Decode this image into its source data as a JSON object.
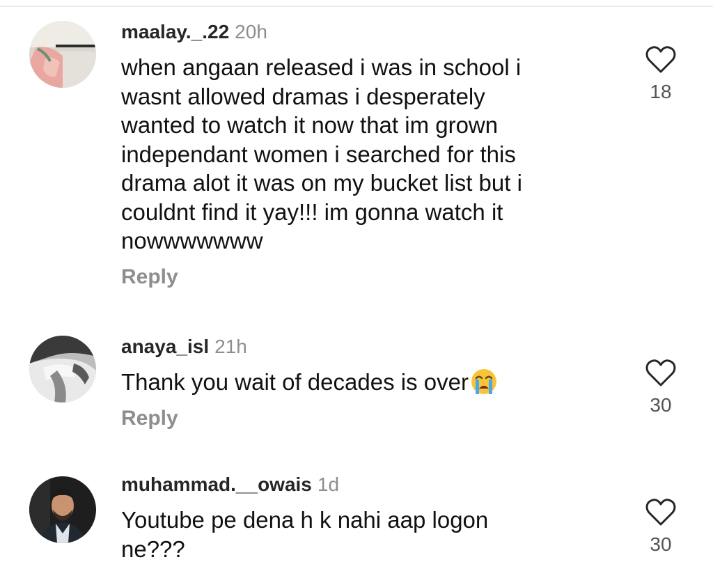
{
  "comments": [
    {
      "username": "maalay._.22",
      "time": "20h",
      "text": "when angaan released i was in school  i\nwasnt allowed dramas i desperately\nwanted to watch it now that im grown\nindependant women i searched for this\ndrama alot it was on my bucket list but i\ncouldnt find it yay!!! im gonna watch it\nnowwwwwww",
      "reply_label": "Reply",
      "likes": "18"
    },
    {
      "username": "anaya_isl",
      "time": "21h",
      "text": "Thank you wait of decades is over",
      "emoji": "loudly-crying-face",
      "reply_label": "Reply",
      "likes": "30"
    },
    {
      "username": "muhammad.__owais",
      "time": "1d",
      "text": "Youtube pe dena h k nahi aap logon\nne???",
      "likes": "30"
    }
  ],
  "colors": {
    "username": "#262626",
    "meta": "#8e8e8e",
    "text": "#111111",
    "like_count": "#555555",
    "heart_outline": "#262626"
  }
}
